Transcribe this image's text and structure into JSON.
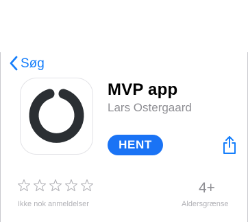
{
  "nav": {
    "back_label": "Søg"
  },
  "app": {
    "title": "MVP app",
    "developer": "Lars Ostergaard",
    "get_label": "HENT"
  },
  "ratings": {
    "stars_filled": 0,
    "stars_total": 5,
    "label": "Ikke nok anmeldelser"
  },
  "age": {
    "value": "4+",
    "label": "Aldersgrænse"
  },
  "icons": {
    "back": "chevron-left-icon",
    "share": "share-icon",
    "app": "ring-icon",
    "star": "star-outline-icon"
  },
  "colors": {
    "accent": "#157efb",
    "get_button": "#1a73f5",
    "app_ring": "#2b2f33",
    "secondary_text": "#8e8e93",
    "muted_text": "#b2b2b7"
  }
}
